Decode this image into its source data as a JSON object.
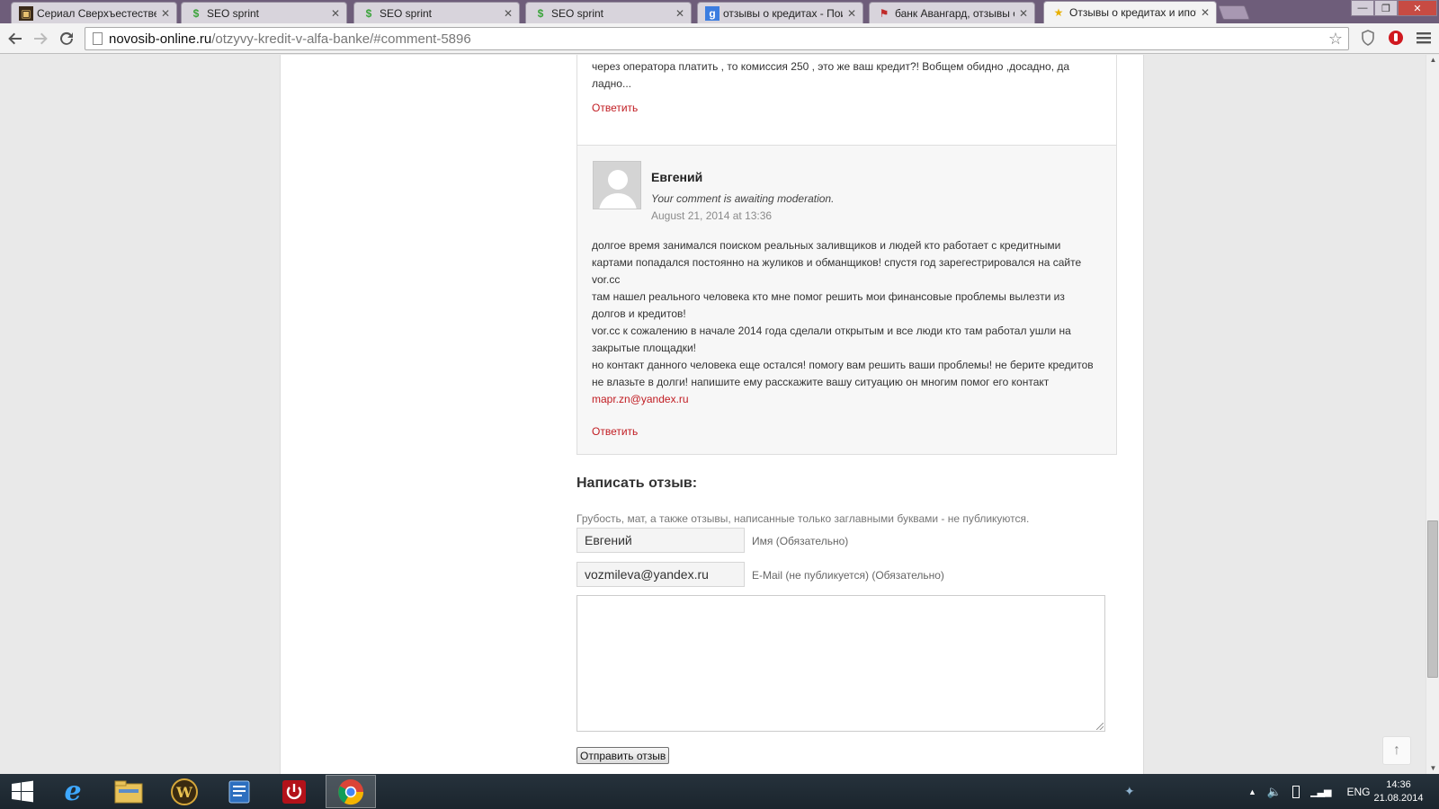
{
  "browser": {
    "tabs": [
      {
        "title": "Сериал Сверхъестественное",
        "favicon": "film-icon"
      },
      {
        "title": "SEO sprint",
        "favicon": "seo-sprint-icon"
      },
      {
        "title": "SEO sprint",
        "favicon": "seo-sprint-icon"
      },
      {
        "title": "SEO sprint",
        "favicon": "seo-sprint-icon"
      },
      {
        "title": "отзывы о кредитах - Поиск",
        "favicon": "google-icon"
      },
      {
        "title": "банк Авангард, отзывы о",
        "favicon": "bank-icon"
      },
      {
        "title": "Отзывы о кредитах и ипотеке",
        "favicon": "star-icon",
        "active": true
      }
    ],
    "address": {
      "host": "novosib-online.ru",
      "path": "/otzyvy-kredit-v-alfa-banke/#comment-5896"
    }
  },
  "page": {
    "prev_comment": {
      "line1": "через оператора платить , то комиссия 250 , это же ваш кредит?! Вобщем обидно ,досадно, да",
      "line2": "ладно...",
      "reply": "Ответить"
    },
    "comment": {
      "author": "Евгений",
      "moderation": "Your comment is awaiting moderation.",
      "date": "August 21, 2014 at 13:36",
      "lines": [
        "долгое время занимался поиском реальных заливщиков и людей кто работает с кредитными",
        "картами попадался постоянно на жуликов и обманщиков! спустя год зарегестрировался на сайте",
        "vor.cc",
        "там нашел реального человека кто мне помог решить мои финансовые проблемы вылезти из",
        "долгов и кредитов!",
        "vor.cc к сожалению в начале 2014 года сделали открытым и все люди кто там работал ушли на",
        "закрытые площадки!",
        "но контакт данного человека еще остался! помогу вам решить ваши проблемы! не берите кредитов",
        "не влазьте в долги! напишите ему расскажите вашу ситуацию он многим помог его контакт"
      ],
      "email": "mapr.zn@yandex.ru",
      "reply": "Ответить"
    },
    "form": {
      "title": "Написать отзыв:",
      "note": "Грубость, мат, а также отзывы, написанные только заглавными буквами - не публикуются.",
      "name_value": "Евгений",
      "name_label": "Имя (Обязательно)",
      "email_value": "vozmileva@yandex.ru",
      "email_label": "E-Mail (не публикуется) (Обязательно)",
      "submit": "Отправить отзыв"
    }
  },
  "taskbar": {
    "lang": "ENG",
    "time": "14:36",
    "date": "21.08.2014"
  }
}
